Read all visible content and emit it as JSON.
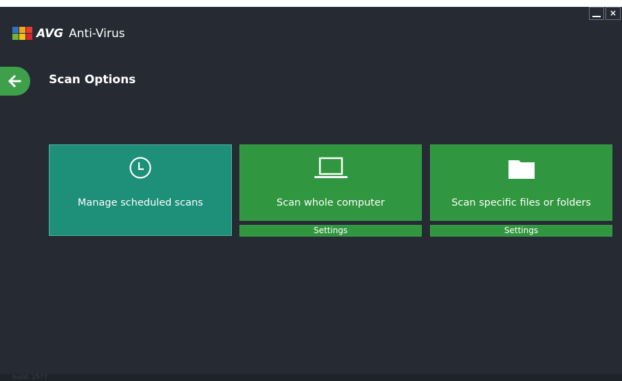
{
  "window": {
    "minimize_icon": "minimize-icon",
    "close_label": "×"
  },
  "brand": {
    "logo": "avg-logo",
    "avg": "AVG",
    "name": "Anti-Virus"
  },
  "header": {
    "back_icon": "arrow-left-icon",
    "title": "Scan Options"
  },
  "tiles": [
    {
      "label": "Manage scheduled scans",
      "icon": "clock-icon",
      "color": "#1e8f79"
    },
    {
      "label": "Scan whole computer",
      "icon": "laptop-icon",
      "color": "#30963f",
      "settings_label": "Settings"
    },
    {
      "label": "Scan specific files or folders",
      "icon": "folder-icon",
      "color": "#30963f",
      "settings_label": "Settings"
    }
  ],
  "footer": {
    "build": "build: 2577"
  },
  "colors": {
    "background": "#252a33",
    "accent_green": "#3ea04a",
    "teal": "#1e8f79"
  }
}
